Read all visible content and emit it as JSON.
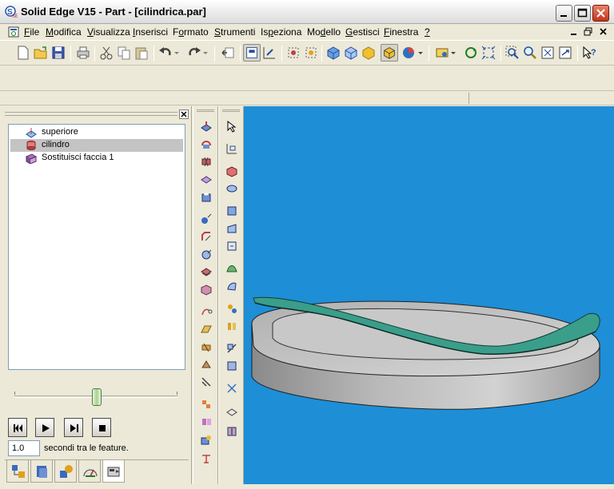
{
  "window": {
    "title": "Solid Edge V15 - Part - [cilindrica.par]"
  },
  "menu": {
    "items": [
      {
        "label": "File",
        "underline": "F"
      },
      {
        "label": "Modifica",
        "underline": "M"
      },
      {
        "label": "Visualizza",
        "underline": "V"
      },
      {
        "label": "Inserisci",
        "underline": "I"
      },
      {
        "label": "Formato",
        "underline": "o"
      },
      {
        "label": "Strumenti",
        "underline": "S"
      },
      {
        "label": "Ispeziona",
        "underline": "p"
      },
      {
        "label": "Modello",
        "underline": "d"
      },
      {
        "label": "Gestisci",
        "underline": "G"
      },
      {
        "label": "Finestra",
        "underline": "F"
      },
      {
        "label": "?",
        "underline": "?"
      }
    ]
  },
  "pathfinder": {
    "items": [
      {
        "label": "superiore",
        "icon": "plane-icon",
        "selected": false
      },
      {
        "label": "cilindro",
        "icon": "cylinder-icon",
        "selected": true
      },
      {
        "label": "Sostituisci faccia 1",
        "icon": "replace-face-icon",
        "selected": false
      }
    ],
    "seconds_value": "1.0",
    "seconds_label": "secondi tra le feature."
  },
  "colors": {
    "viewport_bg": "#1e8ed6",
    "part_gray": "#a0a0a0",
    "surface_teal": "#3a9e8a",
    "selection_bg": "#c4c4c4"
  }
}
